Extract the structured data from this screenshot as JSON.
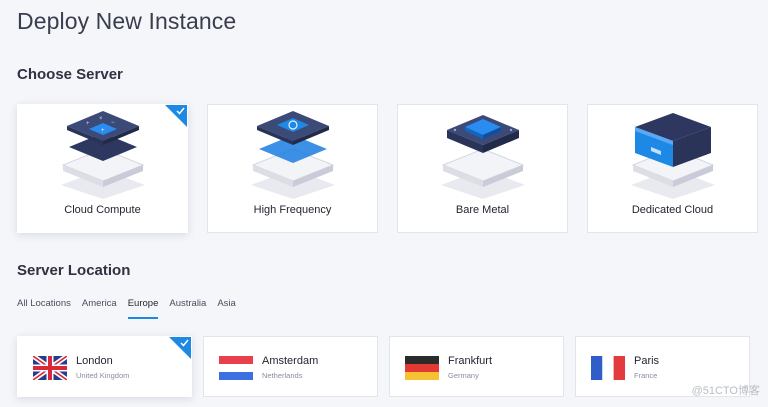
{
  "page": {
    "title": "Deploy New Instance"
  },
  "choose_server": {
    "title": "Choose Server",
    "options": [
      {
        "label": "Cloud Compute",
        "selected": true,
        "icon": "cloud-compute-server-icon"
      },
      {
        "label": "High Frequency",
        "selected": false,
        "icon": "high-frequency-server-icon"
      },
      {
        "label": "Bare Metal",
        "selected": false,
        "icon": "bare-metal-server-icon"
      },
      {
        "label": "Dedicated Cloud",
        "selected": false,
        "icon": "dedicated-cloud-server-icon"
      }
    ]
  },
  "server_location": {
    "title": "Server Location",
    "tabs": [
      {
        "label": "All Locations",
        "active": false
      },
      {
        "label": "America",
        "active": false
      },
      {
        "label": "Europe",
        "active": true
      },
      {
        "label": "Australia",
        "active": false
      },
      {
        "label": "Asia",
        "active": false
      }
    ],
    "locations": [
      {
        "city": "London",
        "country": "United Kingdom",
        "selected": true,
        "flag": "uk-flag-icon"
      },
      {
        "city": "Amsterdam",
        "country": "Netherlands",
        "selected": false,
        "flag": "netherlands-flag-icon"
      },
      {
        "city": "Frankfurt",
        "country": "Germany",
        "selected": false,
        "flag": "germany-flag-icon"
      },
      {
        "city": "Paris",
        "country": "France",
        "selected": false,
        "flag": "france-flag-icon"
      }
    ]
  },
  "watermark": "@51CTO博客",
  "colors": {
    "accent": "#1e88e5",
    "background": "#f5f6fa",
    "card_border": "#e3e5ec"
  }
}
